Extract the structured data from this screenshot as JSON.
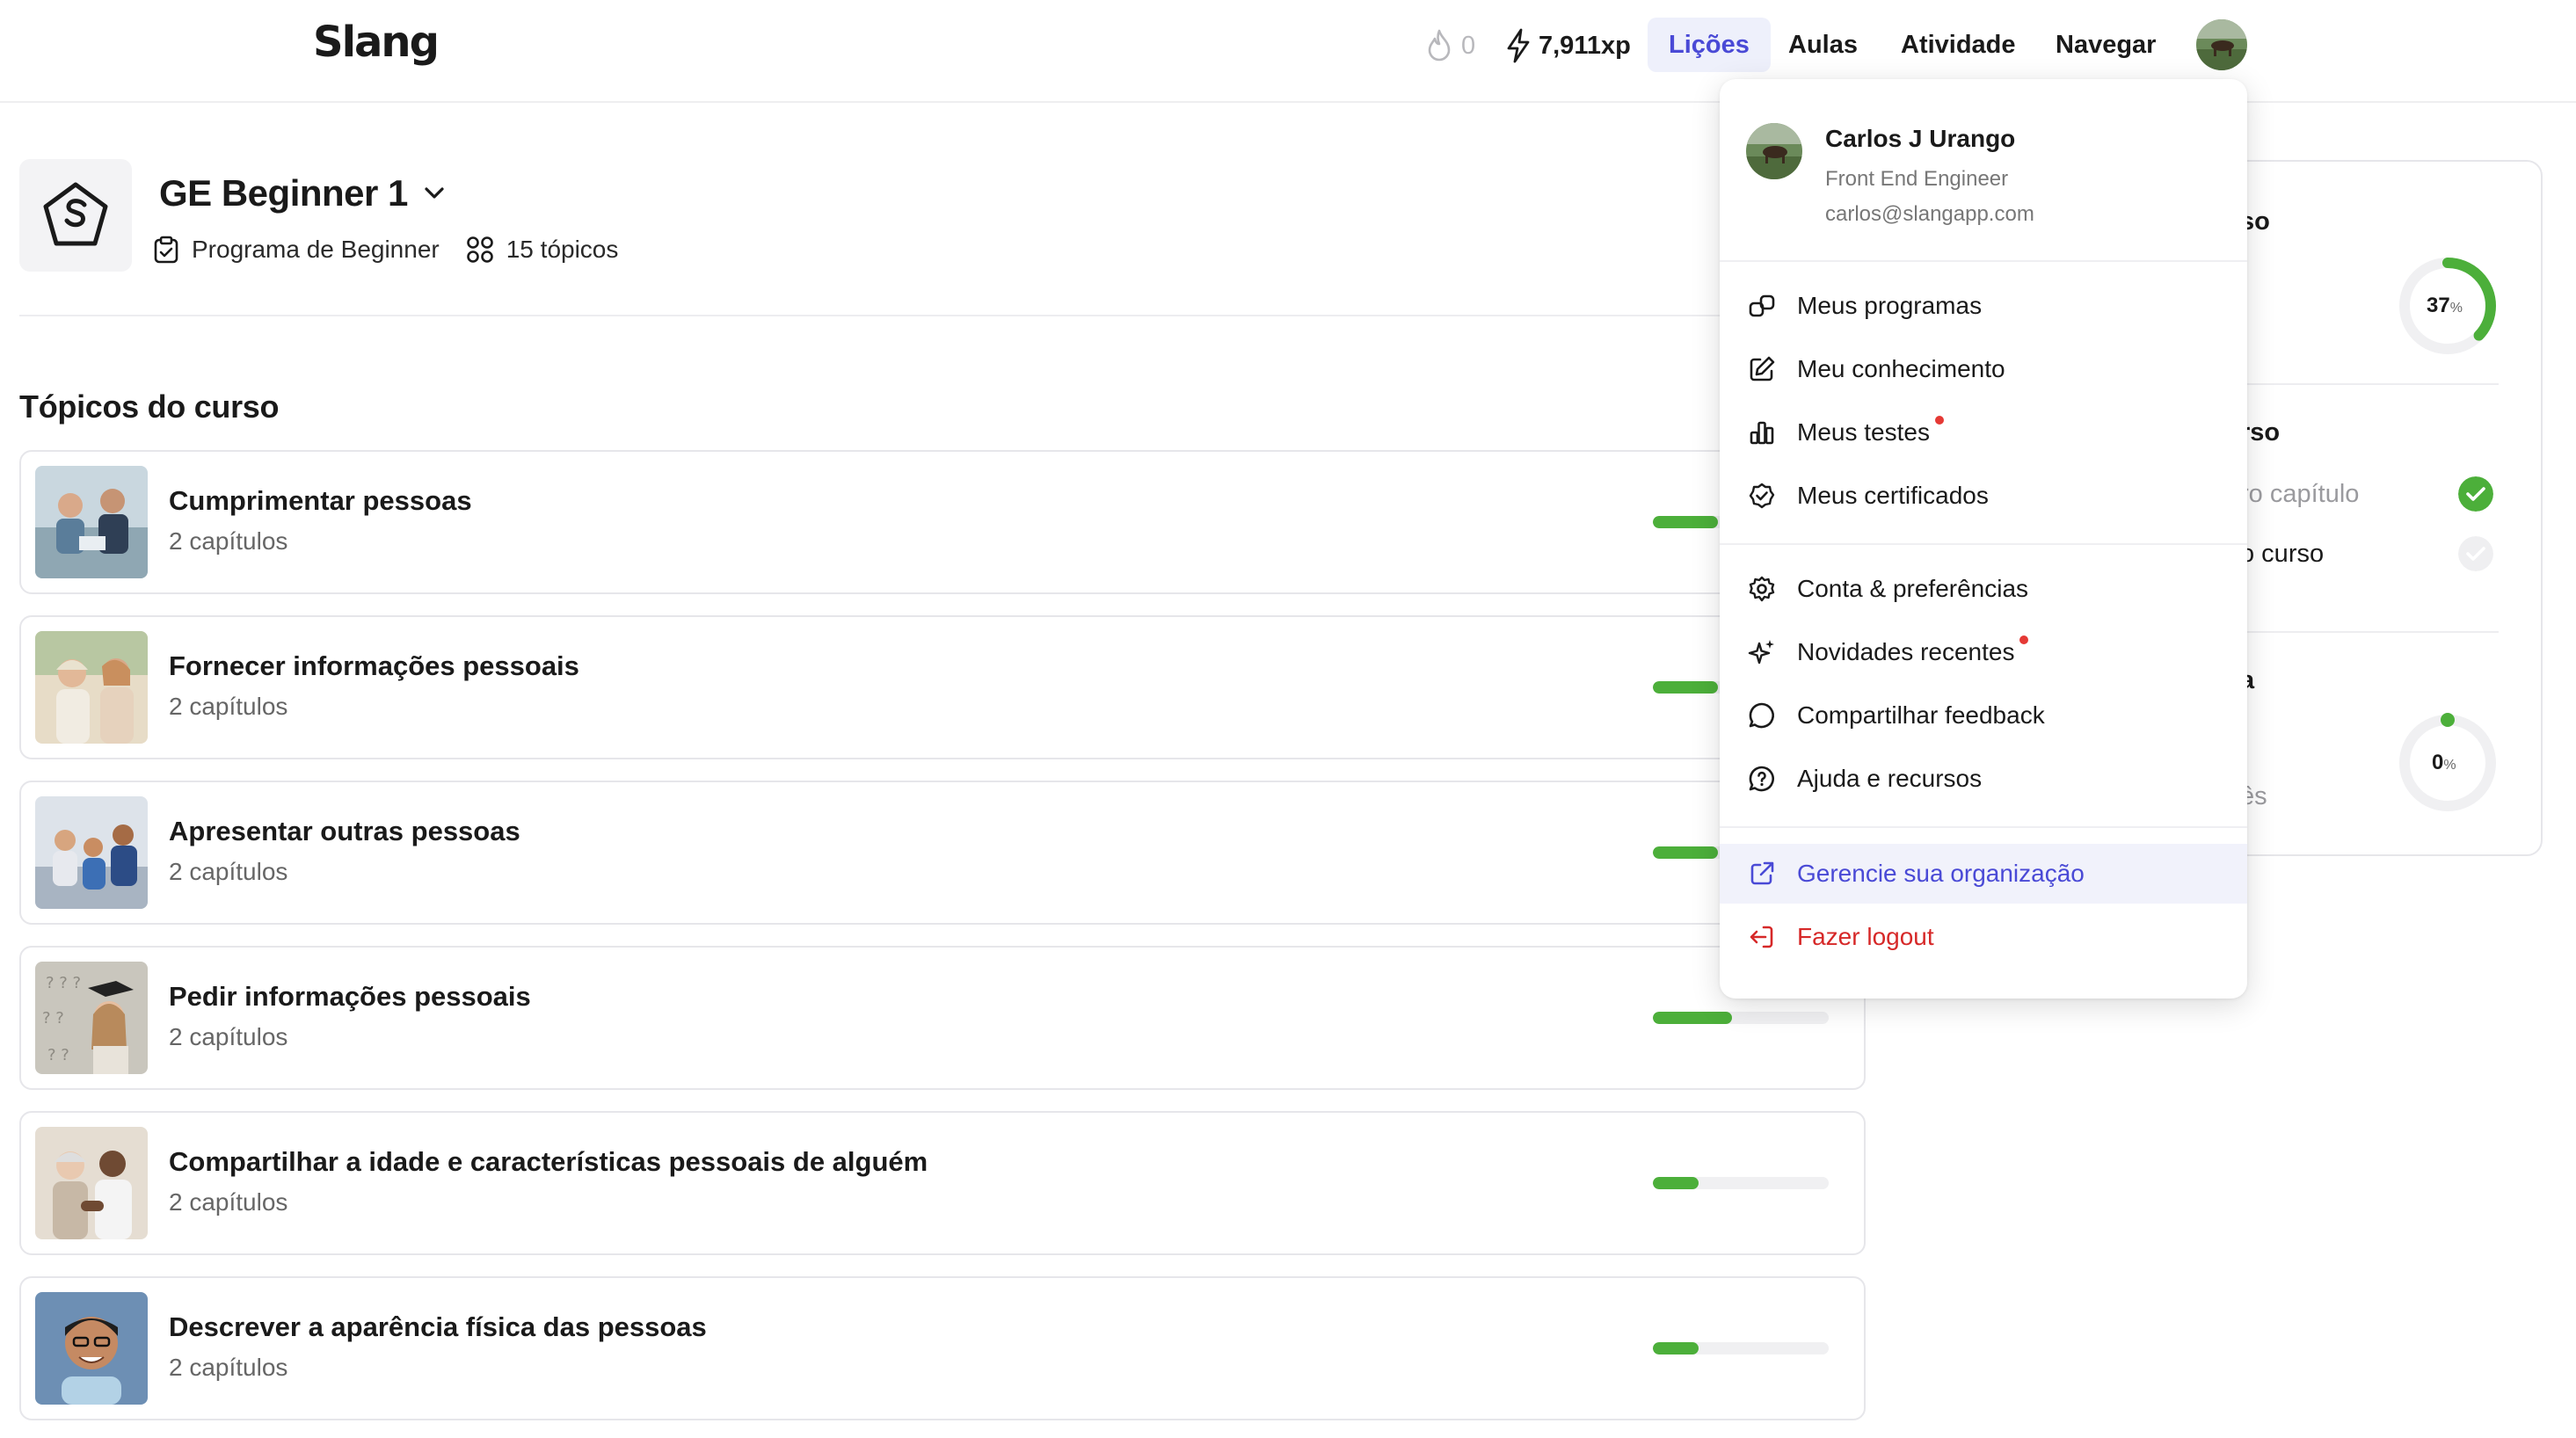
{
  "header": {
    "logo": "Slang",
    "streak": "0",
    "xp": "7,911xp",
    "nav": [
      "Lições",
      "Aulas",
      "Atividade",
      "Navegar"
    ],
    "active_nav": "Lições"
  },
  "course": {
    "title": "GE Beginner 1",
    "program": "Programa de Beginner",
    "topics_count": "15 tópicos"
  },
  "section_title": "Tópicos do curso",
  "topics": [
    {
      "title": "Cumprimentar pessoas",
      "subtitle": "2 capítulos",
      "progress": 0.37
    },
    {
      "title": "Fornecer informações pessoais",
      "subtitle": "2 capítulos",
      "progress": 0.37
    },
    {
      "title": "Apresentar outras pessoas",
      "subtitle": "2 capítulos",
      "progress": 0.37
    },
    {
      "title": "Pedir informações pessoais",
      "subtitle": "2 capítulos",
      "progress": 0.45
    },
    {
      "title": "Compartilhar a idade e características pessoais de alguém",
      "subtitle": "2 capítulos",
      "progress": 0.26
    },
    {
      "title": "Descrever a aparência física das pessoas",
      "subtitle": "2 capítulos",
      "progress": 0.26
    }
  ],
  "right_panel": {
    "heading1": "so",
    "ring1_value": "37",
    "ring1_unit": "%",
    "heading2": "rso",
    "item1": "ro capítulo",
    "item2": "o curso",
    "heading3": "a",
    "item3": "ês",
    "ring2_value": "0",
    "ring2_unit": "%"
  },
  "dropdown": {
    "user_name": "Carlos J Urango",
    "user_role": "Front End Engineer",
    "user_email": "carlos@slangapp.com",
    "items": [
      "Meus programas",
      "Meu conhecimento",
      "Meus testes",
      "Meus certificados",
      "Conta & preferências",
      "Novidades recentes",
      "Compartilhar feedback",
      "Ajuda e recursos",
      "Gerencie sua organização",
      "Fazer logout"
    ]
  },
  "colors": {
    "accent": "#4a4ad6",
    "progress": "#4caf3a",
    "danger": "#d62828"
  }
}
